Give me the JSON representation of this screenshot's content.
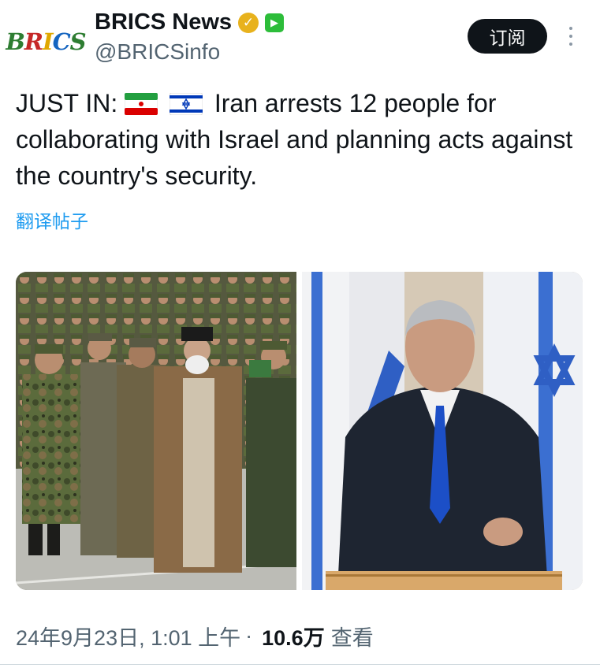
{
  "account": {
    "avatar_text": "BRICS",
    "display_name": "BRICS News",
    "handle": "@BRICSinfo",
    "verified_icon": "gold-check-badge",
    "affiliate_icon": "affiliate-badge"
  },
  "actions": {
    "subscribe_label": "订阅",
    "more_icon": "more-vertical-icon"
  },
  "tweet": {
    "prefix": "JUST IN:",
    "flags": [
      "iran-flag",
      "israel-flag"
    ],
    "body": "Iran arrests 12 people for collaborating with Israel and planning acts against the country's security.",
    "translate_label": "翻译帖子"
  },
  "media": {
    "images": [
      {
        "description_icon": "photo-military-leaders-saluting"
      },
      {
        "description_icon": "photo-speaker-at-podium-with-flags"
      }
    ]
  },
  "meta": {
    "timestamp": "24年9月23日, 1:01 上午",
    "separator": "·",
    "views": "10.6万",
    "views_label": "查看"
  },
  "colors": {
    "accent": "#1d9bf0",
    "text": "#0f1419",
    "muted": "#536471",
    "subscribe_bg": "#0f1419"
  }
}
